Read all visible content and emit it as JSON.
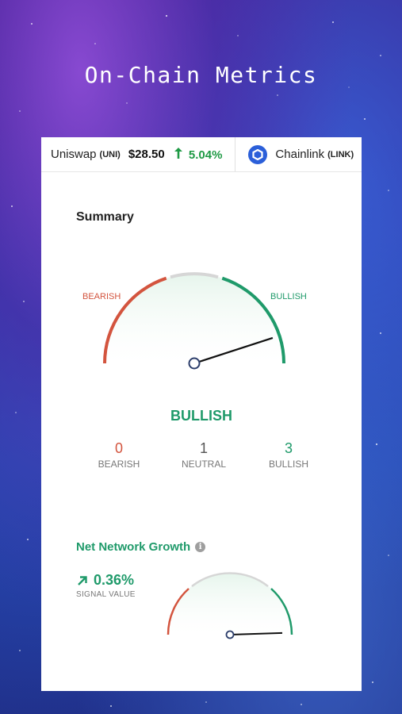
{
  "header": {
    "title": "On-Chain Metrics"
  },
  "ticker": [
    {
      "name": "Uniswap",
      "symbol": "(UNI)",
      "price": "$28.50",
      "change": "5.04%",
      "direction": "up"
    },
    {
      "name": "Chainlink",
      "symbol": "(LINK)"
    }
  ],
  "summary": {
    "title": "Summary",
    "gauge": {
      "left_label": "BEARISH",
      "right_label": "BULLISH",
      "needle_fraction": 0.9
    },
    "verdict": "BULLISH",
    "counts": [
      {
        "value": "0",
        "label": "BEARISH"
      },
      {
        "value": "1",
        "label": "NEUTRAL"
      },
      {
        "value": "3",
        "label": "BULLISH"
      }
    ]
  },
  "net_network_growth": {
    "title": "Net Network Growth",
    "signal_value": "0.36%",
    "signal_label": "SIGNAL VALUE",
    "needle_fraction": 0.99
  },
  "colors": {
    "bullish": "#1f9a6a",
    "bearish": "#d3543e",
    "neutral": "#d6d6d6",
    "price_up": "#1f9a45"
  },
  "icons": {
    "change_up": "arrow-up-icon",
    "signal_up": "arrow-up-right-icon",
    "info": "info-icon",
    "chainlink": "chainlink-logo-icon"
  }
}
